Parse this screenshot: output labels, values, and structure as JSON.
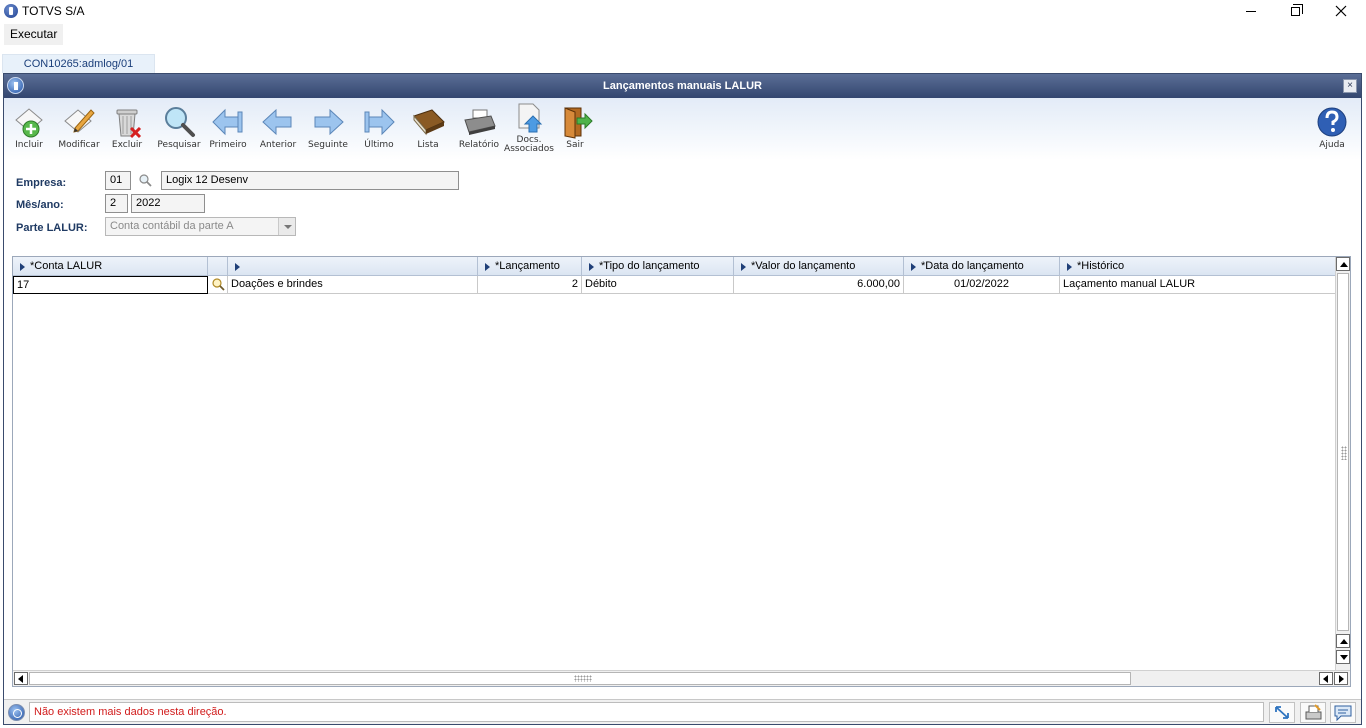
{
  "app": {
    "title": "TOTVS S/A",
    "menu": [
      "Executar"
    ],
    "tab": "CON10265:admlog/01"
  },
  "window": {
    "title": "Lançamentos manuais LALUR",
    "close": "×"
  },
  "toolbar": {
    "buttons": [
      {
        "label": "Incluir",
        "icon": "add-document-icon"
      },
      {
        "label": "Modificar",
        "icon": "edit-document-icon"
      },
      {
        "label": "Excluir",
        "icon": "trash-delete-icon"
      },
      {
        "label": "Pesquisar",
        "icon": "magnifier-icon"
      },
      {
        "label": "Primeiro",
        "icon": "first-arrow-icon"
      },
      {
        "label": "Anterior",
        "icon": "previous-arrow-icon"
      },
      {
        "label": "Seguinte",
        "icon": "next-arrow-icon"
      },
      {
        "label": "Último",
        "icon": "last-arrow-icon"
      },
      {
        "label": "Lista",
        "icon": "book-list-icon"
      },
      {
        "label": "Relatório",
        "icon": "printer-icon"
      },
      {
        "label_line1": "Docs.",
        "label_line2": "Associados",
        "icon": "document-upload-icon"
      },
      {
        "label": "Sair",
        "icon": "exit-door-icon"
      },
      {
        "label": "Ajuda",
        "icon": "help-icon"
      }
    ]
  },
  "form": {
    "empresa": {
      "label": "Empresa:",
      "code": "01",
      "name": "Logix 12 Desenv"
    },
    "mes_ano": {
      "label": "Mês/ano:",
      "mes": "2",
      "ano": "2022"
    },
    "parte_lalur": {
      "label": "Parte LALUR:",
      "value": "Conta contábil da parte A"
    }
  },
  "grid": {
    "columns": [
      "*Conta LALUR",
      "",
      "",
      "*Lançamento",
      "*Tipo do lançamento",
      "*Valor do lançamento",
      "*Data do lançamento",
      "*Histórico"
    ],
    "rows": [
      {
        "conta": "17",
        "descricao": "Doações e brindes",
        "lancamento": "2",
        "tipo": "Débito",
        "valor": "6.000,00",
        "data": "01/02/2022",
        "historico": "Laçamento manual LALUR"
      }
    ]
  },
  "status": {
    "message": "Não existem mais dados nesta direção."
  },
  "colors": {
    "title_gradient_top": "#5b6e96",
    "title_gradient_bottom": "#33466f",
    "label_color": "#1f3a63",
    "status_message_color": "#d11b1b"
  }
}
